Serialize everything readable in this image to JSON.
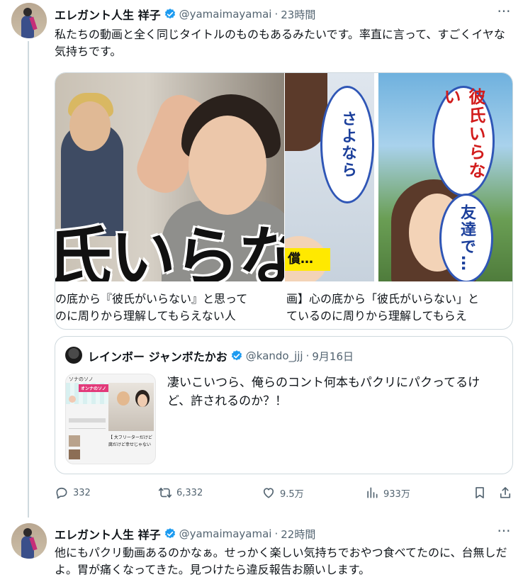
{
  "colors": {
    "text_primary": "#0f1419",
    "text_secondary": "#536471",
    "verified_blue": "#1d9bf0",
    "border": "#cfd9de"
  },
  "tweet1": {
    "name": "エレガント人生 祥子",
    "handle": "@yamaimayamai",
    "separator": "·",
    "time": "23時間",
    "text": "私たちの動画と全く同じタイトルのものもあるみたいです。率直に言って、すごくイヤな気持ちです。",
    "media": {
      "left_overlay_text": "氏いらな",
      "right_bubbles": [
        "さよなら",
        "彼氏いらない",
        "友達で…"
      ],
      "right_tag": "償…",
      "caption_left": [
        "の底から『彼氏がいらない』と思って",
        "のに周りから理解してもらえない人"
      ],
      "caption_right": [
        "画】心の底から「彼氏がいらない」と",
        "ているのに周りから理解してもらえ"
      ]
    },
    "quote": {
      "name": "レインボー ジャンボたかお",
      "handle": "@kando_jjj",
      "separator": "·",
      "date": "9月16日",
      "text": "凄いこいつら、俺らのコント何本もパクリにパクってるけど、許されるのか？！",
      "thumb": {
        "top_text": "ソナのソノ",
        "badge": "オンナのソノ",
        "caption": "【 大フリーターだけど",
        "caption2": "腐だけど幸せじゃない"
      }
    },
    "actions": {
      "reply": "332",
      "retweet": "6,332",
      "like": "9.5万",
      "views": "933万"
    }
  },
  "tweet2": {
    "name": "エレガント人生 祥子",
    "handle": "@yamaimayamai",
    "separator": "·",
    "time": "22時間",
    "text": "他にもパクリ動画あるのかなぁ。せっかく楽しい気持ちでおやつ食べてたのに、台無しだよ。胃が痛くなってきた。見つけたら違反報告お願いします。"
  }
}
